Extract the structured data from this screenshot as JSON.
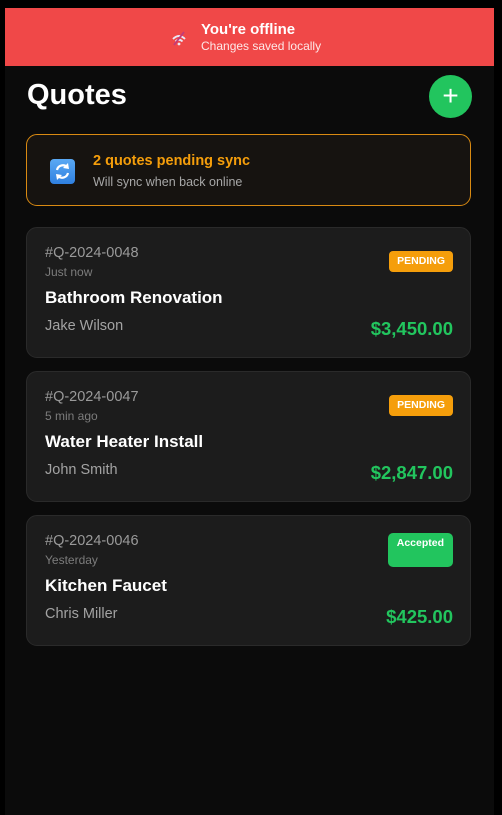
{
  "banner": {
    "title": "You're offline",
    "subtitle": "Changes saved locally",
    "icon": "wifi-off-icon",
    "color": "#f04848"
  },
  "header": {
    "title": "Quotes",
    "add_label": "+",
    "accent": "#22c55e"
  },
  "sync": {
    "title": "2 quotes pending sync",
    "subtitle": "Will sync when back online",
    "icon": "sync-icon",
    "color": "#f59e0b"
  },
  "quotes": [
    {
      "id": "#Q-2024-0048",
      "time": "Just now",
      "title": "Bathroom Renovation",
      "client": "Jake Wilson",
      "amount": "$3,450.00",
      "status": "PENDING"
    },
    {
      "id": "#Q-2024-0047",
      "time": "5 min ago",
      "title": "Water Heater Install",
      "client": "John Smith",
      "amount": "$2,847.00",
      "status": "PENDING"
    },
    {
      "id": "#Q-2024-0046",
      "time": "Yesterday",
      "title": "Kitchen Faucet",
      "client": "Chris Miller",
      "amount": "$425.00",
      "status": "Accepted"
    }
  ]
}
